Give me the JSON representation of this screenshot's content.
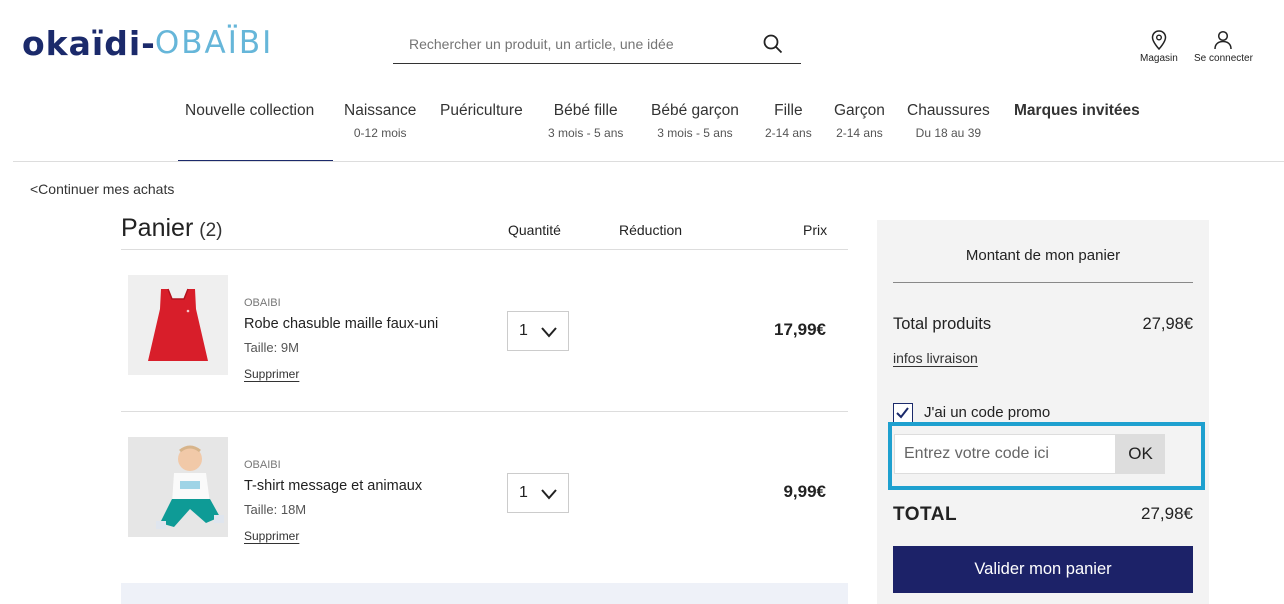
{
  "header": {
    "logo_left": "okaïdi",
    "logo_dash": "-",
    "logo_right": "OBAÏBI",
    "search_placeholder": "Rechercher un produit, un article, une idée",
    "store_label": "Magasin",
    "login_label": "Se connecter"
  },
  "nav": {
    "items": [
      {
        "label": "Nouvelle collection",
        "sub": ""
      },
      {
        "label": "Naissance",
        "sub": "0-12 mois"
      },
      {
        "label": "Puériculture",
        "sub": ""
      },
      {
        "label": "Bébé fille",
        "sub": "3 mois - 5 ans"
      },
      {
        "label": "Bébé garçon",
        "sub": "3 mois - 5 ans"
      },
      {
        "label": "Fille",
        "sub": "2-14 ans"
      },
      {
        "label": "Garçon",
        "sub": "2-14 ans"
      },
      {
        "label": "Chaussures",
        "sub": "Du 18 au 39"
      },
      {
        "label": "Marques invitées",
        "sub": ""
      }
    ]
  },
  "cart": {
    "continue_label": "<Continuer mes achats",
    "title": "Panier",
    "count": "(2)",
    "col_quantity": "Quantité",
    "col_reduction": "Réduction",
    "col_price": "Prix",
    "products": [
      {
        "brand": "OBAIBI",
        "name": "Robe chasuble maille faux-uni",
        "size": "Taille: 9M",
        "remove": "Supprimer",
        "qty": "1",
        "price": "17,99€"
      },
      {
        "brand": "OBAIBI",
        "name": "T-shirt message et animaux",
        "size": "Taille: 18M",
        "remove": "Supprimer",
        "qty": "1",
        "price": "9,99€"
      }
    ]
  },
  "summary": {
    "title": "Montant de mon panier",
    "total_products_label": "Total produits",
    "total_products_value": "27,98€",
    "delivery_link": "infos livraison",
    "promo_checkbox_label": "J'ai un code promo",
    "promo_placeholder": "Entrez votre code ici",
    "promo_ok": "OK",
    "total_label": "TOTAL",
    "total_value": "27,98€",
    "validate_label": "Valider mon panier"
  },
  "colors": {
    "brand_navy": "#1b2a6b",
    "brand_light_blue": "#66b6d9",
    "highlight": "#1ea0cf",
    "button": "#1c2268"
  }
}
